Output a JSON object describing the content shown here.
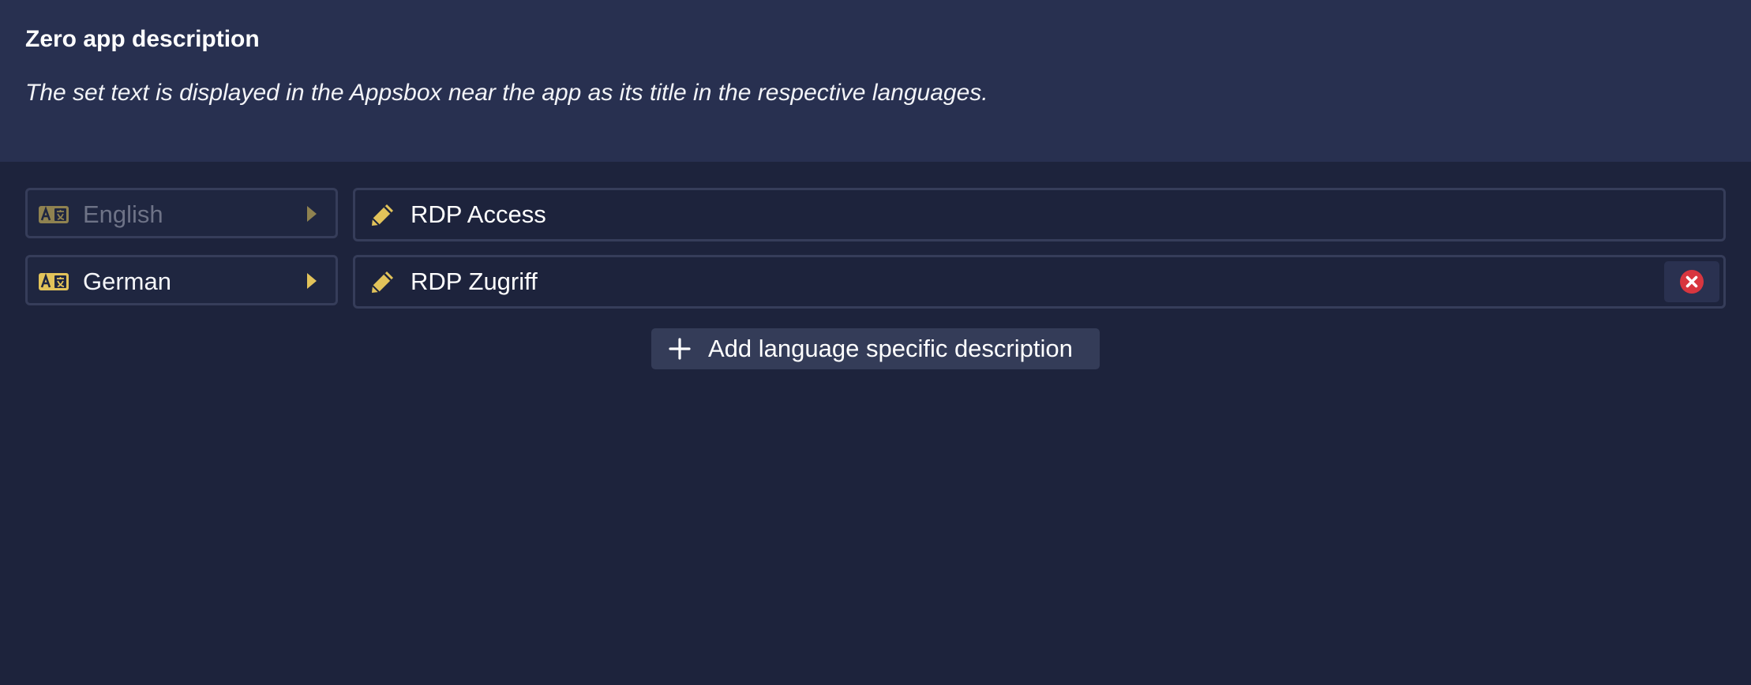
{
  "header": {
    "title": "Zero app description",
    "description": "The set text is displayed in the Appsbox near the app as its title in the respective languages."
  },
  "rows": [
    {
      "language": "English",
      "value": "RDP Access",
      "language_icon": "translate-icon",
      "edit_icon": "pencil-icon",
      "removable": false
    },
    {
      "language": "German",
      "value": "RDP Zugriff",
      "language_icon": "translate-icon",
      "edit_icon": "pencil-icon",
      "removable": true,
      "remove_icon": "close-circle-icon"
    }
  ],
  "add_button": {
    "label": "Add language specific description",
    "icon": "plus-icon"
  },
  "colors": {
    "background": "#1d233c",
    "header_background": "#283050",
    "accent_yellow": "#e2c35a",
    "remove_red": "#d8363f",
    "border": "#363d5a"
  }
}
